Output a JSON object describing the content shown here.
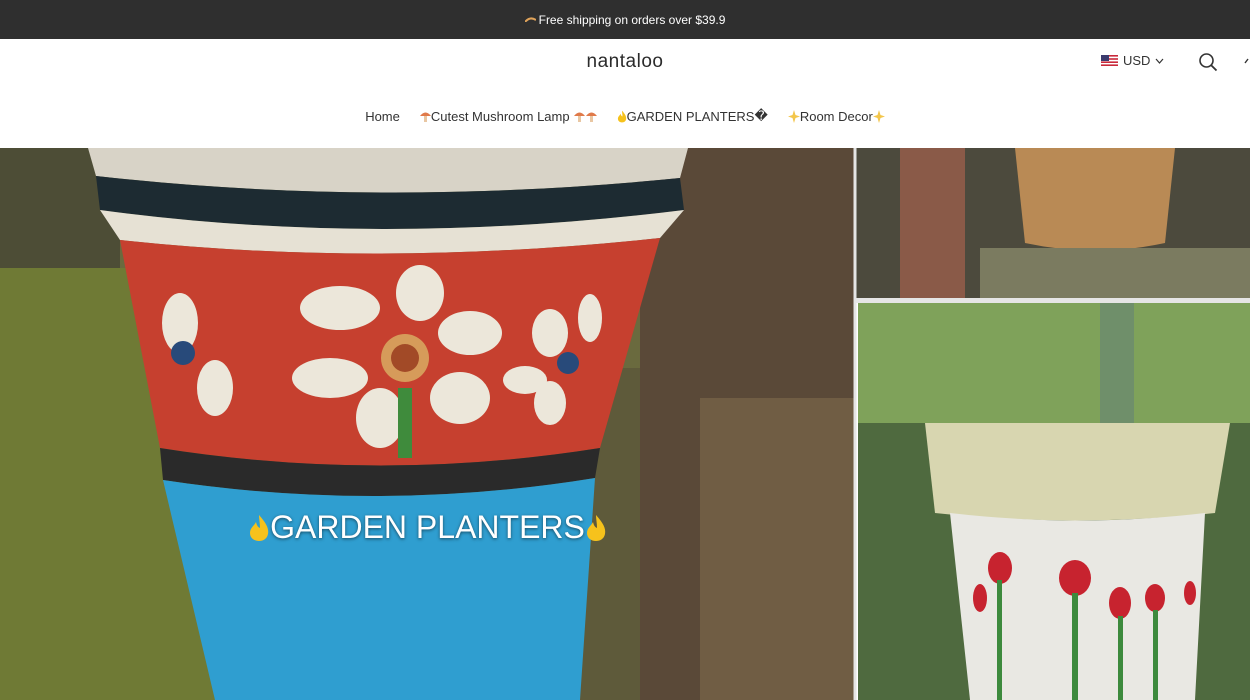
{
  "announcement": {
    "text": "Free shipping on orders over $39.9",
    "icon": "small-decor-icon"
  },
  "header": {
    "logo": "nantaloo",
    "currency": {
      "code": "USD",
      "flag": "us-flag-icon"
    },
    "icons": [
      "search-icon",
      "cart-icon"
    ]
  },
  "nav": {
    "items": [
      {
        "label": "Home"
      },
      {
        "label": "Cutest Mushroom Lamp",
        "icon": "mushroom-icon"
      },
      {
        "label": "GARDEN PLANTERS",
        "icon": "flame-icon",
        "suffix": "�"
      },
      {
        "label": "Room Decor",
        "icon": "sparkle-icon"
      }
    ]
  },
  "hero": {
    "title": "GARDEN PLANTERS",
    "icon": "flame-icon"
  },
  "colors": {
    "announcement_bg": "#2f2f2f",
    "header_bg": "#ffffff",
    "flame": "#f6c21c"
  }
}
